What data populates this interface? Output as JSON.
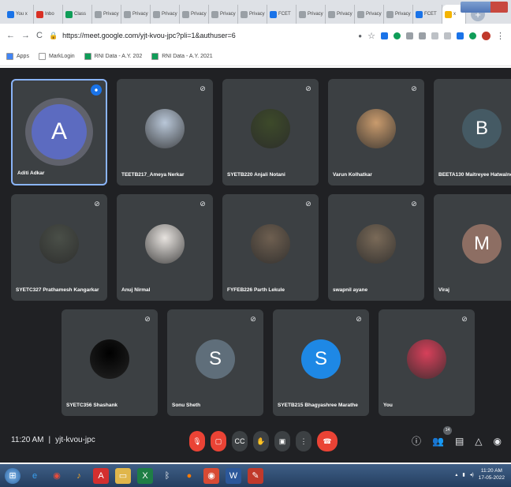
{
  "browser": {
    "tabs": [
      {
        "label": "You x",
        "color": "#1a73e8"
      },
      {
        "label": "Inbo",
        "color": "#d93025"
      },
      {
        "label": "Class",
        "color": "#0f9d58"
      },
      {
        "label": "Privacy",
        "color": "#9aa0a6"
      },
      {
        "label": "Privacy",
        "color": "#9aa0a6"
      },
      {
        "label": "Privacy",
        "color": "#9aa0a6"
      },
      {
        "label": "Privacy",
        "color": "#9aa0a6"
      },
      {
        "label": "Privacy",
        "color": "#9aa0a6"
      },
      {
        "label": "Privacy",
        "color": "#9aa0a6"
      },
      {
        "label": "FCET",
        "color": "#1a73e8"
      },
      {
        "label": "Privacy",
        "color": "#9aa0a6"
      },
      {
        "label": "Privacy",
        "color": "#9aa0a6"
      },
      {
        "label": "Privacy",
        "color": "#9aa0a6"
      },
      {
        "label": "Privacy",
        "color": "#9aa0a6"
      },
      {
        "label": "FCET",
        "color": "#1a73e8"
      }
    ],
    "active_tab_label": "x",
    "url": "https://meet.google.com/yjt-kvou-jpc?pli=1&authuser=6",
    "bookmarks": [
      {
        "label": "Apps",
        "color": "#4285f4"
      },
      {
        "label": "MarkLogin",
        "color": "#ffffff"
      },
      {
        "label": "RNI Data - A.Y. 202",
        "color": "#0f9d58"
      },
      {
        "label": "RNI Data - A.Y. 2021",
        "color": "#0f9d58"
      }
    ]
  },
  "participants": [
    {
      "name": "Aditi Adkar",
      "initial": "A",
      "kind": "letter",
      "color": "#5c6bc0",
      "speaking": true
    },
    {
      "name": "TEETB217_Ameya Nerkar",
      "initial": "",
      "kind": "photo",
      "color": "#b9c7d8"
    },
    {
      "name": "SYETB220 Anjali Notani",
      "initial": "",
      "kind": "photo",
      "color": "#3d4a2a"
    },
    {
      "name": "Varun Kolhatkar",
      "initial": "",
      "kind": "photo",
      "color": "#c99b6d"
    },
    {
      "name": "BEETA130 Maitreyee Hatwalne",
      "initial": "B",
      "kind": "letter",
      "color": "#455a64"
    },
    {
      "name": "SYETC327 Prathamesh Kangarkar",
      "initial": "",
      "kind": "photo",
      "color": "#4a4f48"
    },
    {
      "name": "Anuj Nirmal",
      "initial": "",
      "kind": "photo",
      "color": "#e7e3df"
    },
    {
      "name": "FYFEB226 Parth Lekule",
      "initial": "",
      "kind": "photo",
      "color": "#6e5f50"
    },
    {
      "name": "swapnil ayane",
      "initial": "",
      "kind": "photo",
      "color": "#7a6a58"
    },
    {
      "name": "Viraj",
      "initial": "M",
      "kind": "letter",
      "color": "#8d6e63"
    },
    {
      "name": "SYETC356 Shashank",
      "initial": "",
      "kind": "photo",
      "color": "#000000"
    },
    {
      "name": "Sonu Sheth",
      "initial": "S",
      "kind": "letter",
      "color": "#5f6e7a"
    },
    {
      "name": "SYETB215 Bhagyashree Marathe",
      "initial": "S",
      "kind": "letter",
      "color": "#1e88e5"
    },
    {
      "name": "You",
      "initial": "",
      "kind": "photo",
      "color": "#d7405a"
    }
  ],
  "meeting": {
    "time": "11:20 AM",
    "separator": "|",
    "code": "yjt-kvou-jpc",
    "people_count": "14"
  },
  "taskbar": {
    "time": "11:20 AM",
    "date": "17-05-2022"
  }
}
